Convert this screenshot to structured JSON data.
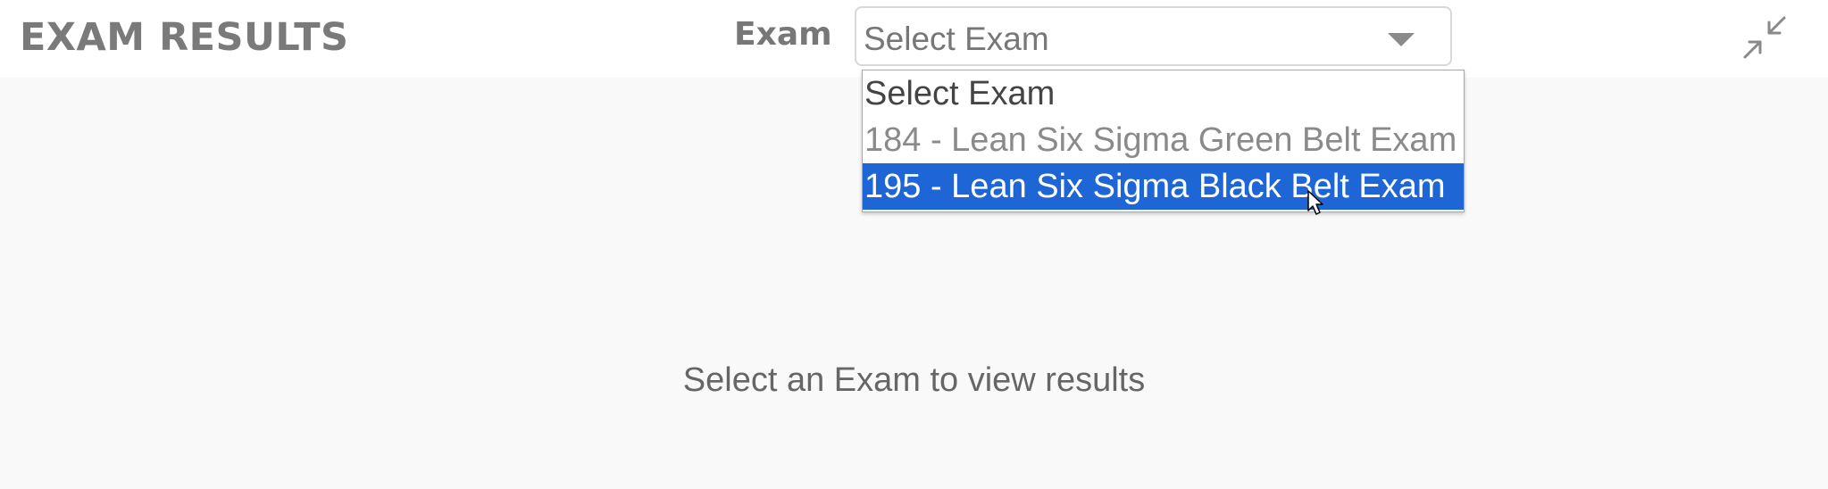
{
  "header": {
    "title": "EXAM RESULTS",
    "exam_label": "Exam"
  },
  "exam_select": {
    "value": "Select Exam",
    "options": [
      "Select Exam",
      "184 - Lean Six Sigma Green Belt Exam",
      "195 - Lean Six Sigma Black Belt Exam"
    ],
    "highlighted_option": "195 - Lean Six Sigma Black Belt Exam"
  },
  "main": {
    "empty_message": "Select an Exam to view results"
  },
  "icons": {
    "collapse": "collapse-arrows-icon",
    "dropdown_arrow": "chevron-down-icon",
    "cursor": "mouse-pointer-icon"
  },
  "colors": {
    "highlight": "#1e66d6",
    "title": "#7a7a7a",
    "background": "#f9f9f9"
  }
}
